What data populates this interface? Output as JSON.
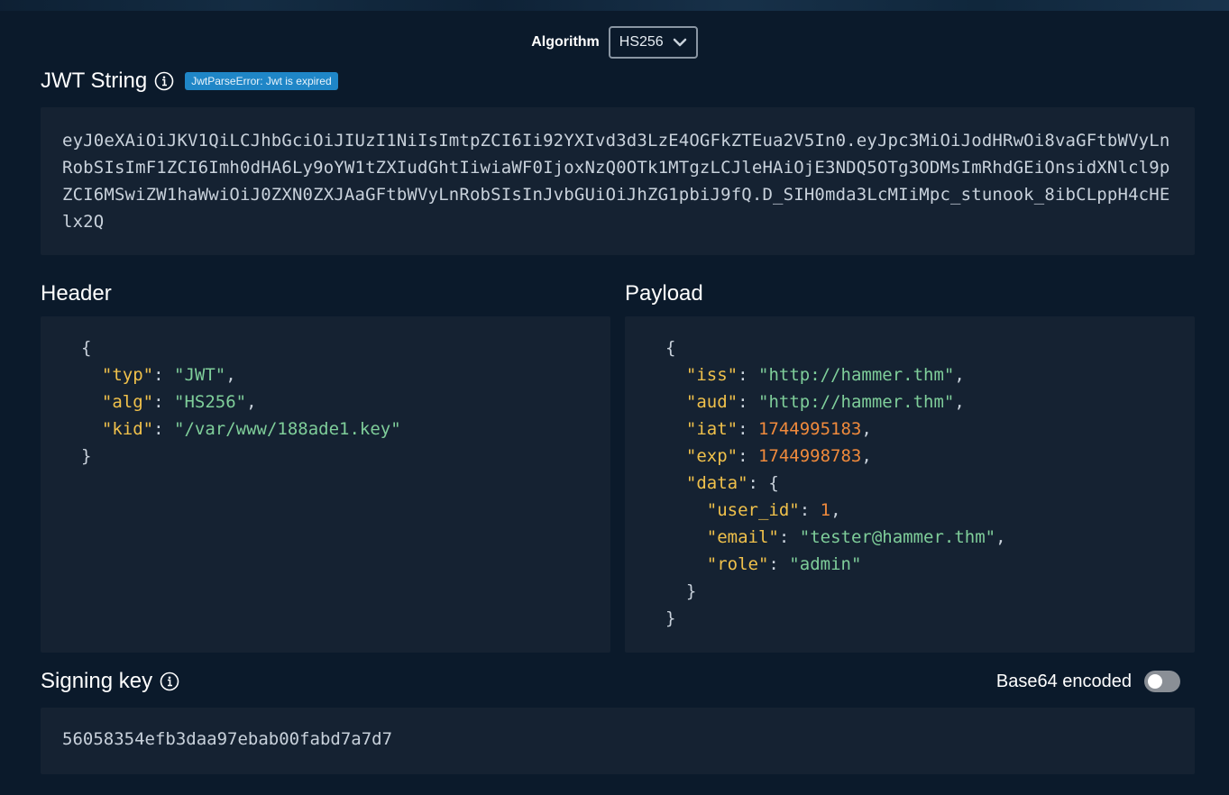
{
  "algorithm": {
    "label": "Algorithm",
    "selected": "HS256"
  },
  "jwt": {
    "title": "JWT String",
    "error_badge": "JwtParseError: Jwt is expired",
    "token": "eyJ0eXAiOiJKV1QiLCJhbGciOiJIUzI1NiIsImtpZCI6Ii92YXIvd3d3LzE4OGFkZTEua2V5In0.eyJpc3MiOiJodHRwOi8vaGFtbWVyLnRobSIsImF1ZCI6Imh0dHA6Ly9oYW1tZXIudGhtIiwiaWF0IjoxNzQ0OTk1MTgzLCJleHAiOjE3NDQ5OTg3ODMsImRhdGEiOnsidXNlcl9pZCI6MSwiZW1haWwiOiJ0ZXN0ZXJAaGFtbWVyLnRobSIsInJvbGUiOiJhZG1pbiJ9fQ.D_SIH0mda3LcMIiMpc_stunook_8ibCLppH4cHElx2Q"
  },
  "header": {
    "title": "Header",
    "typ": "JWT",
    "alg": "HS256",
    "kid": "/var/www/188ade1.key"
  },
  "payload": {
    "title": "Payload",
    "iss": "http://hammer.thm",
    "aud": "http://hammer.thm",
    "iat": "1744995183",
    "exp": "1744998783",
    "data": {
      "user_id": "1",
      "email": "tester@hammer.thm",
      "role": "admin"
    }
  },
  "signing": {
    "title": "Signing key",
    "base64_label": "Base64 encoded",
    "base64_enabled": false,
    "key": "56058354efb3daa97ebab00fabd7a7d7"
  },
  "icons": [
    "info-icon",
    "chevron-down-icon"
  ],
  "colors": {
    "background": "#0b1a2b",
    "panel": "#152232",
    "badge": "#1f86c7",
    "json_key": "#f0c14b",
    "json_string": "#7fce9a",
    "json_number": "#f08a3c"
  }
}
